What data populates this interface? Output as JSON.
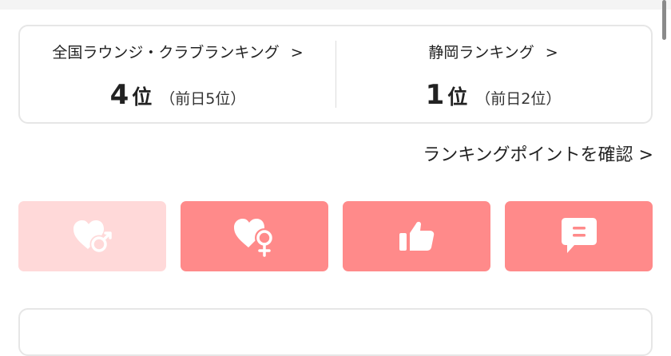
{
  "ranking": {
    "national": {
      "title": "全国ラウンジ・クラブランキング",
      "chevron": ">",
      "rank": "4",
      "unit": "位",
      "previous": "（前日5位）"
    },
    "regional": {
      "title": "静岡ランキング",
      "chevron": ">",
      "rank": "1",
      "unit": "位",
      "previous": "（前日2位）"
    }
  },
  "points_link": {
    "label": "ランキングポイントを確認 >"
  },
  "actions": [
    {
      "icon": "heart-male-icon",
      "state": "inactive"
    },
    {
      "icon": "heart-female-icon",
      "state": "active"
    },
    {
      "icon": "thumbs-up-icon",
      "state": "active"
    },
    {
      "icon": "comment-icon",
      "state": "active"
    }
  ],
  "colors": {
    "active": "#ff8a8a",
    "inactive": "#ffd9d9",
    "icon": "#ffffff"
  }
}
